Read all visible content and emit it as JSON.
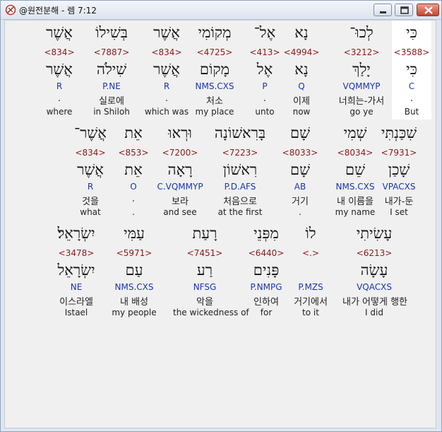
{
  "window": {
    "title": "@원전분해 - 렘 7:12",
    "minimize_icon": "minimize-icon",
    "maximize_icon": "maximize-icon",
    "close_icon": "close-icon"
  },
  "colors": {
    "strong_number": "#8b1a1a",
    "parsing": "#1a35b0",
    "highlight": "#ffffff"
  },
  "rows": [
    {
      "words": [
        {
          "heb": "כִּי",
          "num": "<3588>",
          "lemma": "כִּי",
          "parse": "C",
          "kor": ".",
          "eng": "But"
        },
        {
          "heb": "לְכוּ־",
          "num": "<3212>",
          "lemma": "יָלַךְ",
          "parse": "VQMMYP",
          "kor": "너희는-가서",
          "eng": "go ye"
        },
        {
          "heb": "נָא",
          "num": "<4994>",
          "lemma": "נָא",
          "parse": "Q",
          "kor": "이제",
          "eng": "now"
        },
        {
          "heb": "אֶל־",
          "num": "<413>",
          "lemma": "אֶל",
          "parse": "P",
          "kor": ".",
          "eng": "unto"
        },
        {
          "heb": "מְקוֹמִי",
          "num": "<4725>",
          "lemma": "מָקוֹם",
          "parse": "NMS.CXS",
          "kor": "처소",
          "eng": "my place"
        },
        {
          "heb": "אֲשֶׁר",
          "num": "<834>",
          "lemma": "אֲשֶׁר",
          "parse": "R",
          "kor": ".",
          "eng": "which was"
        },
        {
          "heb": "בְּשִׁילוֹ",
          "num": "<7887>",
          "lemma": "שִׁילֹה",
          "parse": "P.NE",
          "kor": "실로에",
          "eng": "in Shiloh"
        },
        {
          "heb": "אֲשֶׁר",
          "num": "<834>",
          "lemma": "אֲשֶׁר",
          "parse": "R",
          "kor": ".",
          "eng": "where"
        }
      ]
    },
    {
      "words": [
        {
          "heb": "שִׁכַּנְתִּי",
          "num": "<7931>",
          "lemma": "שָׁכַן",
          "parse": "VPACXS",
          "kor": "내가-둔",
          "eng": "I set"
        },
        {
          "heb": "שְׁמִי",
          "num": "<8034>",
          "lemma": "שֵׁם",
          "parse": "NMS.CXS",
          "kor": "내 이름을",
          "eng": "my name"
        },
        {
          "heb": "שָׁם",
          "num": "<8033>",
          "lemma": "שָׁם",
          "parse": "AB",
          "kor": "거기",
          "eng": "."
        },
        {
          "heb": "בָּרִאשׁוֹנָה",
          "num": "<7223>",
          "lemma": "רִאשׁוֹן",
          "parse": "P.D.AFS",
          "kor": "처음으로",
          "eng": "at the first"
        },
        {
          "heb": "וּרְאוּ",
          "num": "<7200>",
          "lemma": "רָאָה",
          "parse": "C.VQMMYP",
          "kor": "보라",
          "eng": "and see"
        },
        {
          "heb": "אֵת",
          "num": "<853>",
          "lemma": "אֵת",
          "parse": "O",
          "kor": ".",
          "eng": "."
        },
        {
          "heb": "אֲשֶׁר־",
          "num": "<834>",
          "lemma": "אֲשֶׁר",
          "parse": "R",
          "kor": "것을",
          "eng": "what"
        }
      ]
    },
    {
      "words": [
        {
          "heb": "עָשִׂיתִי",
          "num": "<6213>",
          "lemma": "עָשָׂה",
          "parse": "VQACXS",
          "kor": "내가 어떻게 행한",
          "eng": "I did"
        },
        {
          "heb": "לוֹ",
          "num": "<.>",
          "lemma": "",
          "parse": "P.MZS",
          "kor": "거기에서",
          "eng": "to it"
        },
        {
          "heb": "מִפְּנֵי",
          "num": "<6440>",
          "lemma": "פָּנִים",
          "parse": "P.NMPG",
          "kor": "인하여",
          "eng": "for"
        },
        {
          "heb": "רָעַת",
          "num": "<7451>",
          "lemma": "רַע",
          "parse": "NFSG",
          "kor": "악을",
          "eng": "the wickedness of"
        },
        {
          "heb": "עַמִּי",
          "num": "<5971>",
          "lemma": "עַם",
          "parse": "NMS.CXS",
          "kor": "내 배성",
          "eng": "my people"
        },
        {
          "heb": "יִשְׂרָאֵל׃",
          "num": "<3478>",
          "lemma": "יִשְׂרָאֵל",
          "parse": "NE",
          "kor": "이스라엘",
          "eng": "Istael"
        }
      ]
    }
  ]
}
